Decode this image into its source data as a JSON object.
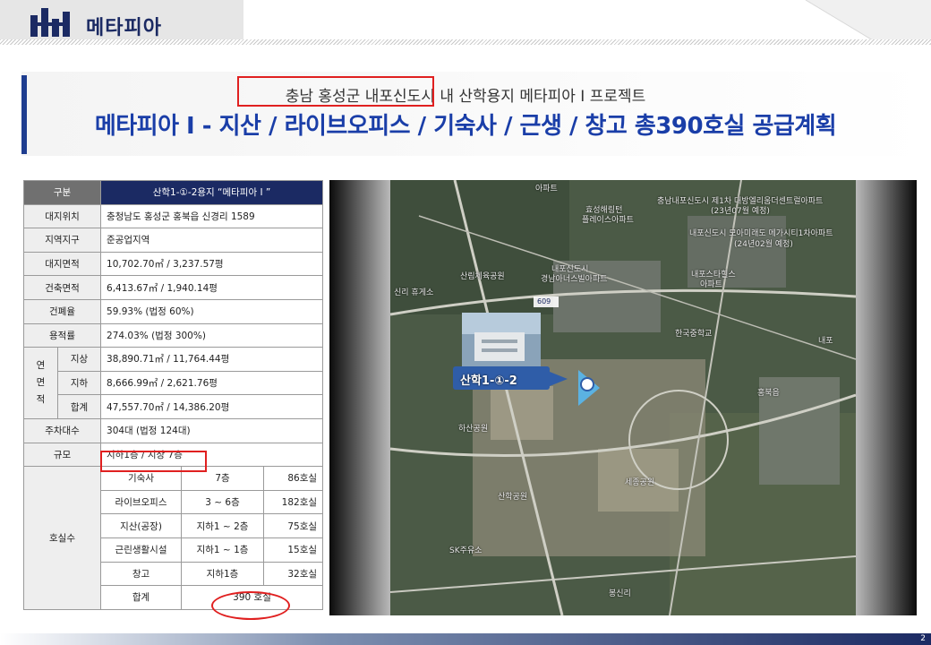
{
  "header": {
    "logo_text": "메타피아"
  },
  "title": {
    "subtitle": "충남 홍성군 내포신도시 내 산학용지 메타피아 I 프로젝트",
    "main": "메타피아 I - 지산 / 라이브오피스 / 기숙사 / 근생 / 창고 총390호실 공급계획"
  },
  "table": {
    "header_left": "구분",
    "header_right": "산학1-①-2용지 “메타피아 I ”",
    "rows": [
      {
        "label": "대지위치",
        "value": "충청남도 홍성군 홍북읍 신경리 1589"
      },
      {
        "label": "지역지구",
        "value": "준공업지역"
      },
      {
        "label": "대지면적",
        "value": "10,702.70㎡ / 3,237.57평"
      },
      {
        "label": "건축면적",
        "value": "6,413.67㎡ / 1,940.14평"
      },
      {
        "label": "건폐율",
        "value": "59.93% (법정 60%)"
      },
      {
        "label": "용적률",
        "value": "274.03% (법정 300%)"
      }
    ],
    "floor_area_label": "연면적",
    "floor_area_label_chars": [
      "연",
      "면",
      "적"
    ],
    "floor_area": [
      {
        "label": "지상",
        "value": "38,890.71㎡ / 11,764.44평"
      },
      {
        "label": "지하",
        "value": "8,666.99㎡ / 2,621.76평"
      },
      {
        "label": "합계",
        "value": "47,557.70㎡ / 14,386.20평"
      }
    ],
    "parking": {
      "label": "주차대수",
      "value": "304대 (법정 124대)"
    },
    "scale": {
      "label": "규모",
      "value": "지하1층 / 지상 7층"
    },
    "units_label": "호실수",
    "units": [
      {
        "type": "기숙사",
        "floors": "7층",
        "count": "86호실"
      },
      {
        "type": "라이브오피스",
        "floors": "3 ~ 6층",
        "count": "182호실"
      },
      {
        "type": "지산(공장)",
        "floors": "지하1 ~ 2층",
        "count": "75호실"
      },
      {
        "type": "근린생활시설",
        "floors": "지하1 ~ 1층",
        "count": "15호실"
      },
      {
        "type": "창고",
        "floors": "지하1층",
        "count": "32호실"
      }
    ],
    "total": {
      "label": "합계",
      "value": "390 호실"
    }
  },
  "map": {
    "site_label": "산학1-①-2",
    "road_number": "609",
    "labels": [
      "아파트",
      "충남내포신도시 제1차 대방엘리움더센트럴아파트",
      "(23년07월 예정)",
      "효성해링턴",
      "플레이스아파트",
      "내포신도시 모아미래도 메가시티1차아파트",
      "(24년02월 예정)",
      "산림체육공원",
      "내포신도시",
      "경남아너스빌아파트",
      "내포스타힐스",
      "아파트",
      "신리 휴게소",
      "한국중학교",
      "홍북읍",
      "하산공원",
      "산학공원",
      "세종공원",
      "SK주유소",
      "봉신리",
      "내포"
    ],
    "colors": {
      "site_label_bg": "#2f5da8",
      "marker": "#58b8f0"
    }
  },
  "footer": {
    "page_number": "2"
  }
}
